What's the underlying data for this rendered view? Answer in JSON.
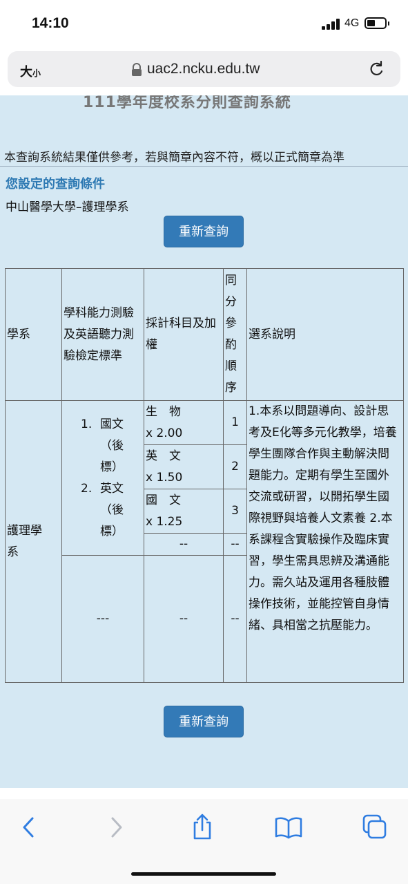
{
  "status": {
    "time": "14:10",
    "network": "4G"
  },
  "browser": {
    "text_size_label": "大",
    "text_size_small": "小",
    "url": "uac2.ncku.edu.tw"
  },
  "page": {
    "title": "111學年度校系分則查詢系統",
    "disclaimer": "本查詢系統結果僅供參考，若與簡章內容不符，概以正式簡章為準",
    "conditions_heading": "您設定的查詢條件",
    "selected": "中山醫學大學–護理學系",
    "requery_label": "重新查詢"
  },
  "table": {
    "headers": {
      "dept": "學系",
      "standards": "學科能力測驗及英語聽力測驗檢定標準",
      "subjects": "採計科目及加權",
      "order": "同分參酌順序",
      "desc": "選系說明"
    },
    "dept": "護理學系",
    "standards": [
      {
        "num": "1.",
        "text": "國文（後標）"
      },
      {
        "num": "2.",
        "text": "英文（後標）"
      }
    ],
    "subjects": [
      {
        "name": "生　物",
        "weight": "x 2.00",
        "order": "1"
      },
      {
        "name": "英　文",
        "weight": "x 1.50",
        "order": "2"
      },
      {
        "name": "國　文",
        "weight": "x 1.25",
        "order": "3"
      }
    ],
    "dash2": "--",
    "dash3": "---",
    "description": "1.本系以問題導向、設計思考及E化等多元化教學，培養學生團隊合作與主動解決問題能力。定期有學生至國外交流或研習，以開拓學生國際視野與培養人文素養 2.本系課程含實驗操作及臨床實習，學生需具思辨及溝通能力。需久站及運用各種肢體操作技術，並能控管自身情緒、具相當之抗壓能力。"
  },
  "icons": [
    "back-icon",
    "forward-icon",
    "share-icon",
    "bookmarks-icon",
    "tabs-icon",
    "lock-icon",
    "reload-icon",
    "signal-icon",
    "battery-icon"
  ]
}
